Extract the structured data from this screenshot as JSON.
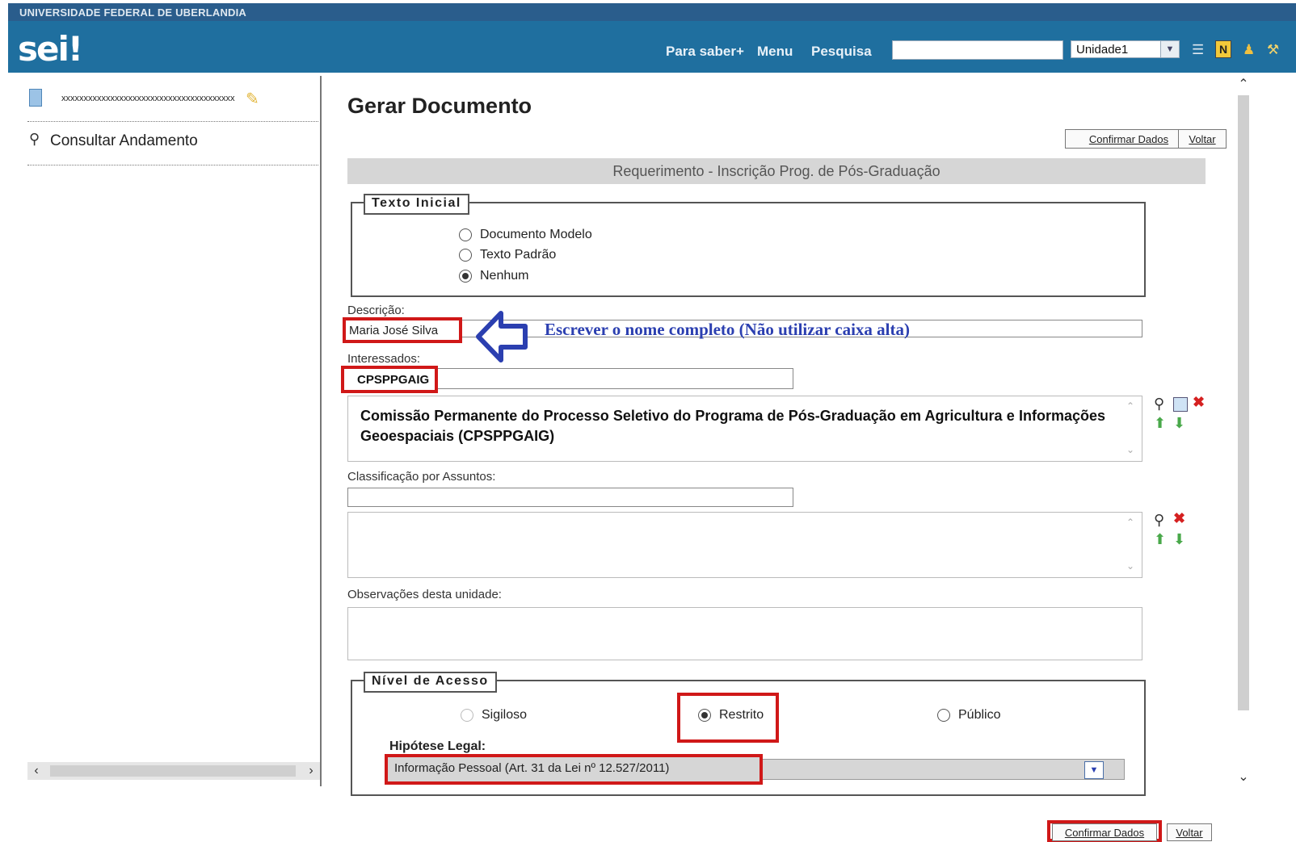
{
  "header": {
    "university": "UNIVERSIDADE FEDERAL DE UBERLANDIA",
    "logo": "sei!",
    "nav": {
      "para_saber": "Para saber+",
      "menu": "Menu",
      "pesquisa": "Pesquisa"
    },
    "search_value": "",
    "unidade": "Unidade1"
  },
  "sidebar": {
    "process_number": "xxxxxxxxxxxxxxxxxxxxxxxxxxxxxxxxxxxxxxx",
    "consultar_label": "Consultar Andamento"
  },
  "main": {
    "title": "Gerar Documento",
    "confirm_label": "Confirmar Dados",
    "back_label": "Voltar",
    "doc_type": "Requerimento - Inscrição Prog. de Pós-Graduação",
    "texto_inicial": {
      "legend": "Texto Inicial",
      "options": [
        "Documento Modelo",
        "Texto Padrão",
        "Nenhum"
      ],
      "selected": "Nenhum"
    },
    "descricao": {
      "label": "Descrição:",
      "value": "Maria José Silva",
      "annotation": "Escrever o nome completo (Não utilizar caixa alta)"
    },
    "interessados": {
      "label": "Interessados:",
      "value": "CPSPPGAIG",
      "list_item": "Comissão Permanente do Processo Seletivo do Programa de Pós-Graduação em Agricultura e Informações Geoespaciais (CPSPPGAIG)"
    },
    "classificacao": {
      "label": "Classificação por Assuntos:",
      "value": ""
    },
    "observacoes": {
      "label": "Observações desta unidade:",
      "value": ""
    },
    "nivel_acesso": {
      "legend": "Nível de Acesso",
      "options": [
        "Sigiloso",
        "Restrito",
        "Público"
      ],
      "selected": "Restrito",
      "hipotese_label": "Hipótese Legal:",
      "hipotese_value": "Informação Pessoal (Art. 31 da Lei nº 12.527/2011)"
    }
  },
  "colors": {
    "header_bg": "#1f6f9f",
    "highlight": "#d01818",
    "annotation": "#2b3fb0"
  }
}
